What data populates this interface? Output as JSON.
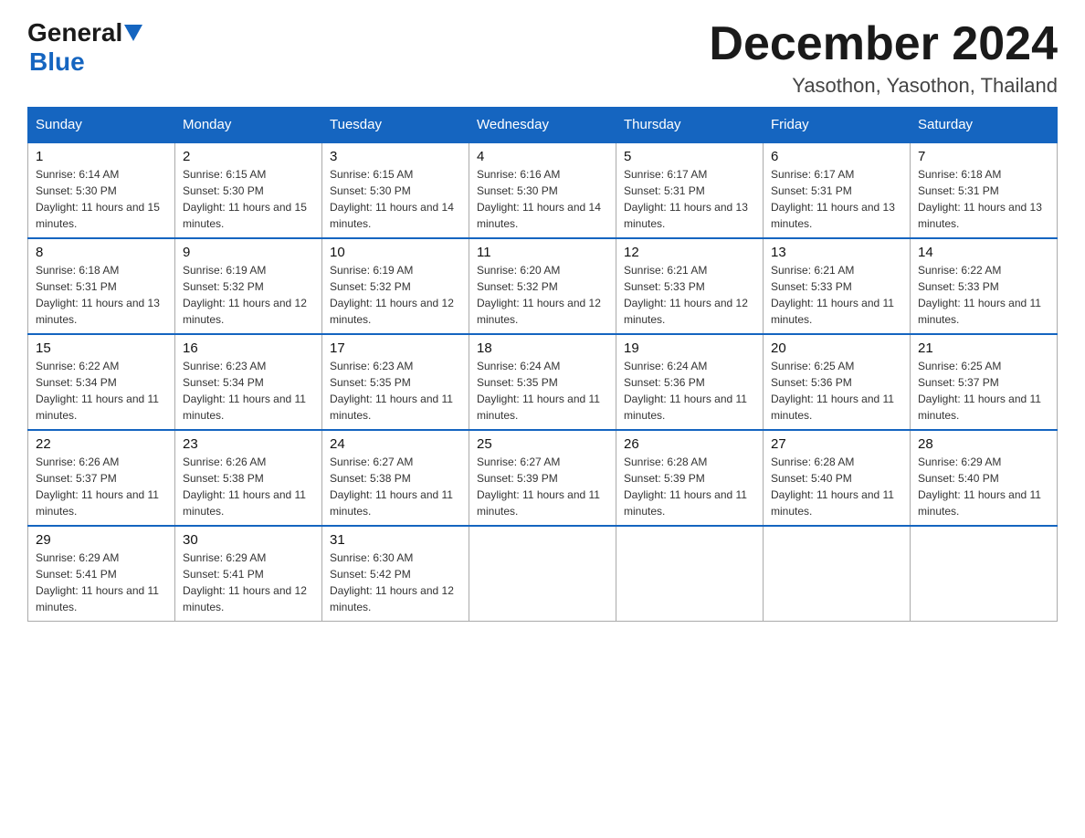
{
  "logo": {
    "general": "General",
    "blue": "Blue"
  },
  "header": {
    "month_title": "December 2024",
    "location": "Yasothon, Yasothon, Thailand"
  },
  "days_of_week": [
    "Sunday",
    "Monday",
    "Tuesday",
    "Wednesday",
    "Thursday",
    "Friday",
    "Saturday"
  ],
  "weeks": [
    [
      {
        "day": "1",
        "sunrise": "6:14 AM",
        "sunset": "5:30 PM",
        "daylight": "11 hours and 15 minutes."
      },
      {
        "day": "2",
        "sunrise": "6:15 AM",
        "sunset": "5:30 PM",
        "daylight": "11 hours and 15 minutes."
      },
      {
        "day": "3",
        "sunrise": "6:15 AM",
        "sunset": "5:30 PM",
        "daylight": "11 hours and 14 minutes."
      },
      {
        "day": "4",
        "sunrise": "6:16 AM",
        "sunset": "5:30 PM",
        "daylight": "11 hours and 14 minutes."
      },
      {
        "day": "5",
        "sunrise": "6:17 AM",
        "sunset": "5:31 PM",
        "daylight": "11 hours and 13 minutes."
      },
      {
        "day": "6",
        "sunrise": "6:17 AM",
        "sunset": "5:31 PM",
        "daylight": "11 hours and 13 minutes."
      },
      {
        "day": "7",
        "sunrise": "6:18 AM",
        "sunset": "5:31 PM",
        "daylight": "11 hours and 13 minutes."
      }
    ],
    [
      {
        "day": "8",
        "sunrise": "6:18 AM",
        "sunset": "5:31 PM",
        "daylight": "11 hours and 13 minutes."
      },
      {
        "day": "9",
        "sunrise": "6:19 AM",
        "sunset": "5:32 PM",
        "daylight": "11 hours and 12 minutes."
      },
      {
        "day": "10",
        "sunrise": "6:19 AM",
        "sunset": "5:32 PM",
        "daylight": "11 hours and 12 minutes."
      },
      {
        "day": "11",
        "sunrise": "6:20 AM",
        "sunset": "5:32 PM",
        "daylight": "11 hours and 12 minutes."
      },
      {
        "day": "12",
        "sunrise": "6:21 AM",
        "sunset": "5:33 PM",
        "daylight": "11 hours and 12 minutes."
      },
      {
        "day": "13",
        "sunrise": "6:21 AM",
        "sunset": "5:33 PM",
        "daylight": "11 hours and 11 minutes."
      },
      {
        "day": "14",
        "sunrise": "6:22 AM",
        "sunset": "5:33 PM",
        "daylight": "11 hours and 11 minutes."
      }
    ],
    [
      {
        "day": "15",
        "sunrise": "6:22 AM",
        "sunset": "5:34 PM",
        "daylight": "11 hours and 11 minutes."
      },
      {
        "day": "16",
        "sunrise": "6:23 AM",
        "sunset": "5:34 PM",
        "daylight": "11 hours and 11 minutes."
      },
      {
        "day": "17",
        "sunrise": "6:23 AM",
        "sunset": "5:35 PM",
        "daylight": "11 hours and 11 minutes."
      },
      {
        "day": "18",
        "sunrise": "6:24 AM",
        "sunset": "5:35 PM",
        "daylight": "11 hours and 11 minutes."
      },
      {
        "day": "19",
        "sunrise": "6:24 AM",
        "sunset": "5:36 PM",
        "daylight": "11 hours and 11 minutes."
      },
      {
        "day": "20",
        "sunrise": "6:25 AM",
        "sunset": "5:36 PM",
        "daylight": "11 hours and 11 minutes."
      },
      {
        "day": "21",
        "sunrise": "6:25 AM",
        "sunset": "5:37 PM",
        "daylight": "11 hours and 11 minutes."
      }
    ],
    [
      {
        "day": "22",
        "sunrise": "6:26 AM",
        "sunset": "5:37 PM",
        "daylight": "11 hours and 11 minutes."
      },
      {
        "day": "23",
        "sunrise": "6:26 AM",
        "sunset": "5:38 PM",
        "daylight": "11 hours and 11 minutes."
      },
      {
        "day": "24",
        "sunrise": "6:27 AM",
        "sunset": "5:38 PM",
        "daylight": "11 hours and 11 minutes."
      },
      {
        "day": "25",
        "sunrise": "6:27 AM",
        "sunset": "5:39 PM",
        "daylight": "11 hours and 11 minutes."
      },
      {
        "day": "26",
        "sunrise": "6:28 AM",
        "sunset": "5:39 PM",
        "daylight": "11 hours and 11 minutes."
      },
      {
        "day": "27",
        "sunrise": "6:28 AM",
        "sunset": "5:40 PM",
        "daylight": "11 hours and 11 minutes."
      },
      {
        "day": "28",
        "sunrise": "6:29 AM",
        "sunset": "5:40 PM",
        "daylight": "11 hours and 11 minutes."
      }
    ],
    [
      {
        "day": "29",
        "sunrise": "6:29 AM",
        "sunset": "5:41 PM",
        "daylight": "11 hours and 11 minutes."
      },
      {
        "day": "30",
        "sunrise": "6:29 AM",
        "sunset": "5:41 PM",
        "daylight": "11 hours and 12 minutes."
      },
      {
        "day": "31",
        "sunrise": "6:30 AM",
        "sunset": "5:42 PM",
        "daylight": "11 hours and 12 minutes."
      },
      null,
      null,
      null,
      null
    ]
  ]
}
